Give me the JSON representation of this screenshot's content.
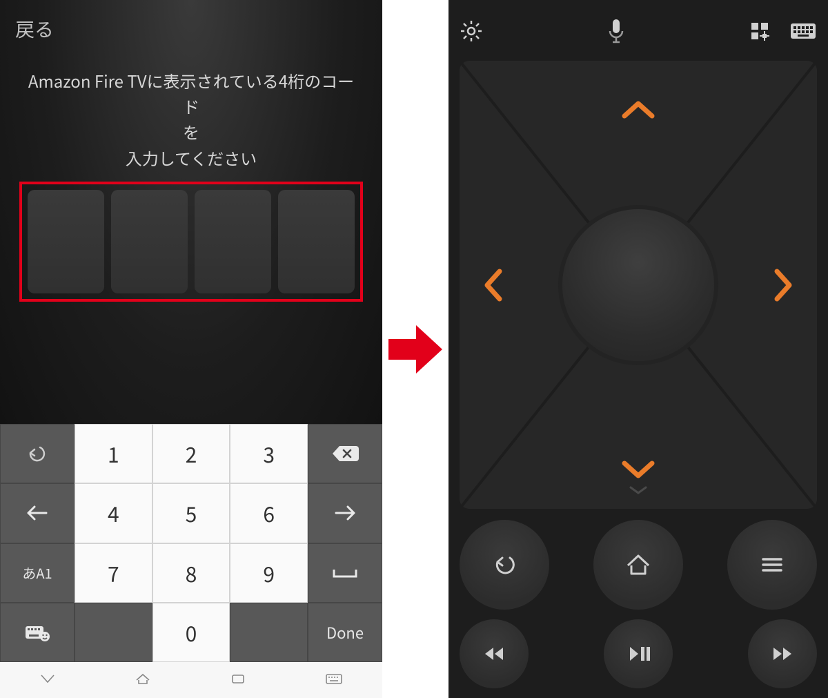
{
  "left_screen": {
    "back_label": "戻る",
    "message_line1": "Amazon Fire TVに表示されている4桁のコード",
    "message_line2": "を",
    "message_line3": "入力してください",
    "code_digit_count": 4,
    "highlight_color": "#e2001a",
    "keypad": {
      "rows": [
        {
          "side_left": "undo-icon",
          "keys": [
            "1",
            "2",
            "3"
          ],
          "side_right": "backspace-icon"
        },
        {
          "side_left": "arrow-left-icon",
          "keys": [
            "4",
            "5",
            "6"
          ],
          "side_right": "arrow-right-icon"
        },
        {
          "side_left_label": "あA1",
          "keys": [
            "7",
            "8",
            "9"
          ],
          "side_right": "space-icon"
        },
        {
          "side_left": "emoji-keyboard-icon",
          "keys": [
            "",
            "0",
            ""
          ],
          "side_right_label": "Done"
        }
      ]
    },
    "navbar_icons": [
      "nav-down-icon",
      "nav-home-icon",
      "nav-recent-icon",
      "nav-keyboard-icon"
    ]
  },
  "transition_icon": "arrow-right-red",
  "right_screen": {
    "topbar": {
      "left_icons": [
        "settings-icon"
      ],
      "center_icon": "mic-icon",
      "right_icons": [
        "apps-icon",
        "keyboard-icon"
      ]
    },
    "dpad": {
      "arrows": [
        "up",
        "down",
        "left",
        "right"
      ],
      "arrow_color": "#ea7c2a",
      "center": "select-button",
      "swipe_hint_icon": "chevron-down-small"
    },
    "controls_row1": [
      "back-icon",
      "home-icon",
      "menu-icon"
    ],
    "controls_row2": [
      "rewind-icon",
      "play-pause-icon",
      "fast-forward-icon"
    ],
    "accent_color": "#ea7c2a"
  }
}
